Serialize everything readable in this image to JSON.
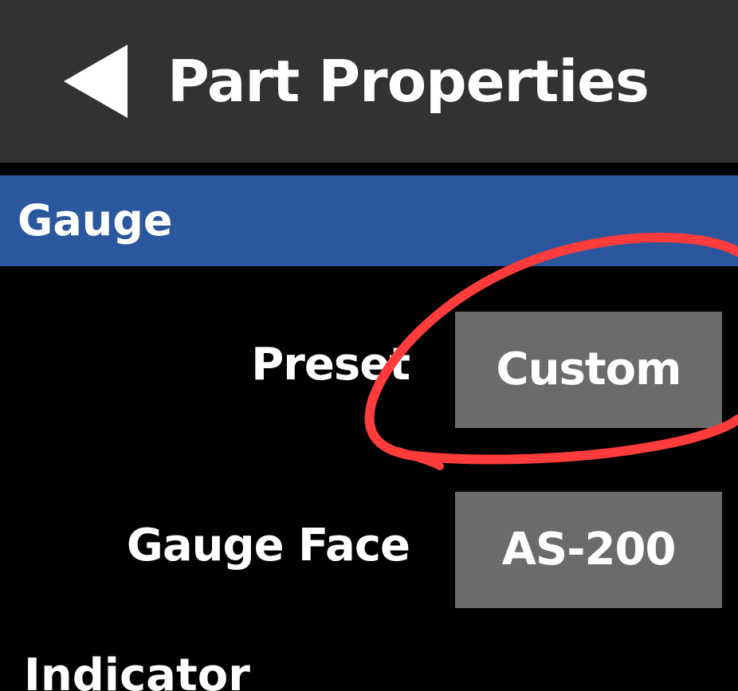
{
  "header": {
    "title": "Part Properties",
    "back_icon": "back-arrow-icon"
  },
  "section": {
    "title": "Gauge"
  },
  "rows": [
    {
      "label": "Preset",
      "value": "Custom"
    },
    {
      "label": "Gauge Face",
      "value": "AS-200"
    }
  ],
  "next_section": {
    "title": "Indicator"
  },
  "colors": {
    "header_bg": "#323232",
    "section_bg": "#2a579e",
    "button_bg": "#6b6b6b",
    "annotation": "#ff3b3b"
  }
}
